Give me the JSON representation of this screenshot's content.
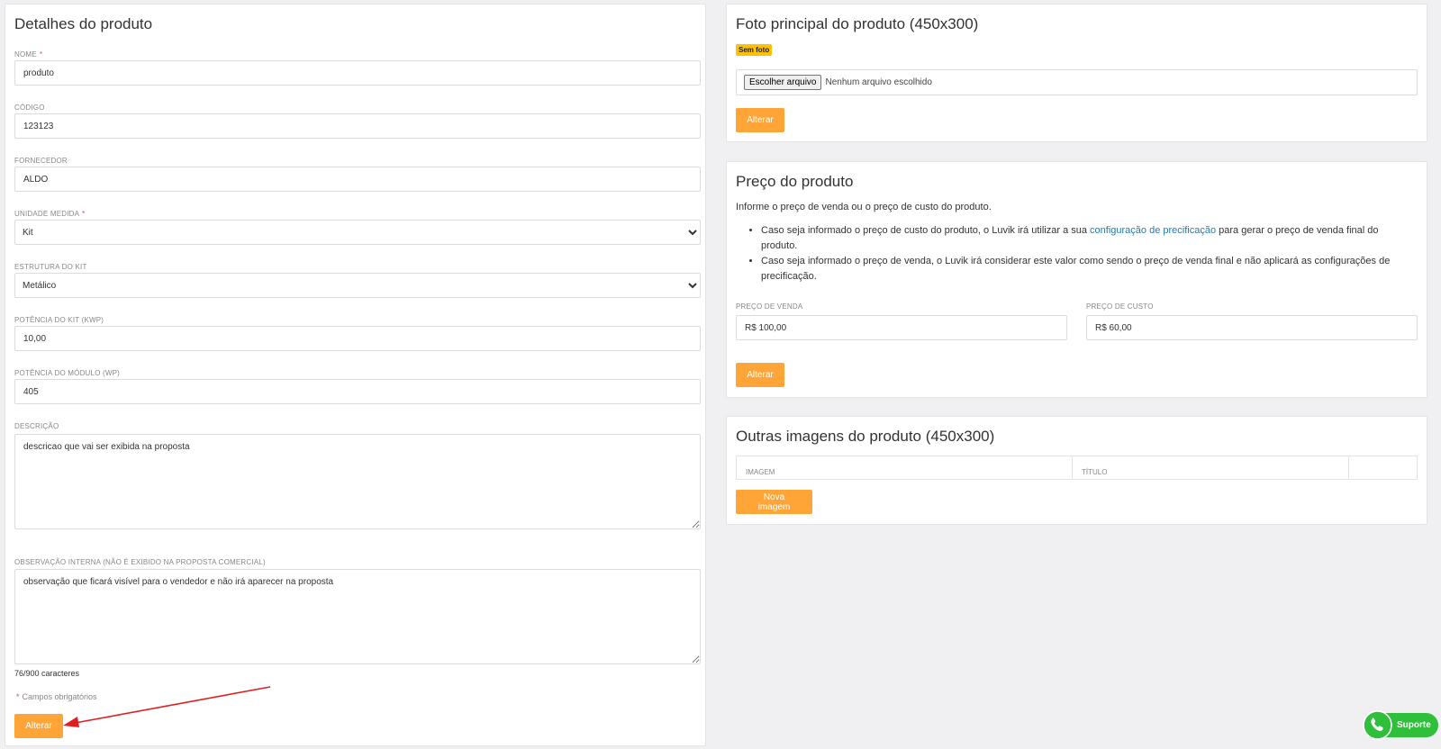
{
  "details": {
    "title": "Detalhes do produto",
    "nome_label": "NOME",
    "nome_value": "produto",
    "codigo_label": "CÓDIGO",
    "codigo_value": "123123",
    "fornecedor_label": "FORNECEDOR",
    "fornecedor_value": "ALDO",
    "unidade_label": "UNIDADE MEDIDA",
    "unidade_value": "Kit",
    "estrutura_label": "ESTRUTURA DO KIT",
    "estrutura_value": "Metálico",
    "potencia_kit_label": "POTÊNCIA DO KIT (KWP)",
    "potencia_kit_value": "10,00",
    "potencia_modulo_label": "POTÊNCIA DO MÓDULO (WP)",
    "potencia_modulo_value": "405",
    "descricao_label": "DESCRIÇÃO",
    "descricao_value": "descricao que vai ser exibida na proposta",
    "observacao_label": "OBSERVAÇÃO INTERNA (NÃO É EXIBIDO NA PROPOSTA COMERCIAL)",
    "observacao_value": "observação que ficará visível para o vendedor e não irá aparecer na proposta",
    "char_counter": "76/900 caracteres",
    "required_asterisk": "*",
    "required_note": "Campos obrigatórios",
    "alterar_label": "Alterar"
  },
  "photo": {
    "title": "Foto principal do produto (450x300)",
    "badge": "Sem foto",
    "file_button": "Escolher arquivo",
    "file_status": "Nenhum arquivo escolhido",
    "alterar_label": "Alterar"
  },
  "price": {
    "title": "Preço do produto",
    "intro": "Informe o preço de venda ou o preço de custo do produto.",
    "bullet1_pre": "Caso seja informado o preço de custo do produto, o Luvik irá utilizar a sua ",
    "bullet1_link": "configuração de precificação",
    "bullet1_post": " para gerar o preço de venda final do produto.",
    "bullet2": "Caso seja informado o preço de venda, o Luvik irá considerar este valor como sendo o preço de venda final e não aplicará as configurações de precificação.",
    "venda_label": "PREÇO DE VENDA",
    "venda_value": "R$ 100,00",
    "custo_label": "PREÇO DE CUSTO",
    "custo_value": "R$ 60,00",
    "alterar_label": "Alterar"
  },
  "images": {
    "title": "Outras imagens do produto (450x300)",
    "col_imagem": "IMAGEM",
    "col_titulo": "TÍTULO",
    "nova_label": "Nova imagem"
  },
  "support": {
    "label": "Suporte",
    "icon": "whatsapp-icon"
  },
  "colors": {
    "accent": "#ffa537",
    "badge": "#ffc107",
    "link": "#2a7aa8",
    "support": "#2fbf3a"
  }
}
